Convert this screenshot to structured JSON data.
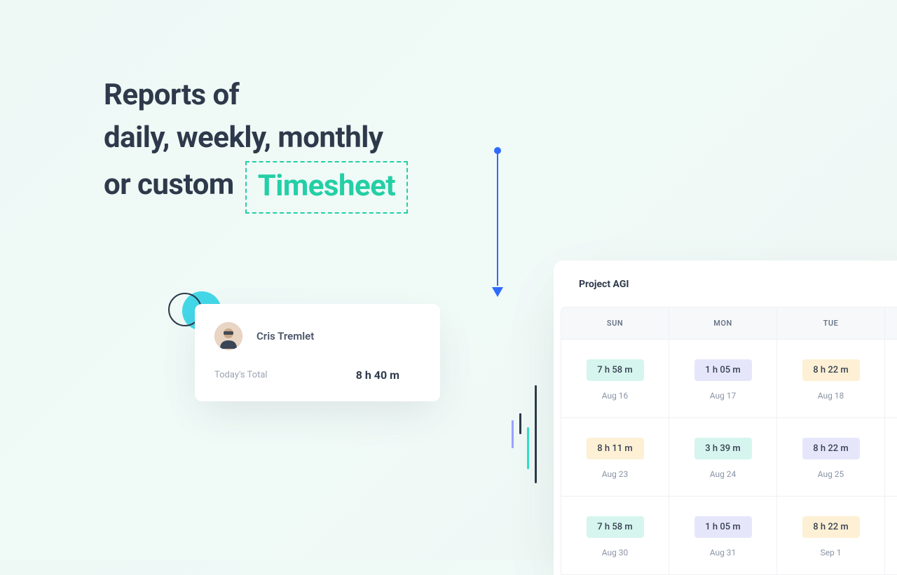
{
  "headline": {
    "line1": "Reports of",
    "line2": "daily, weekly, monthly",
    "line3_prefix": "or custom",
    "highlight": "Timesheet"
  },
  "user_card": {
    "name": "Cris Tremlet",
    "today_label": "Today's Total",
    "today_value": "8 h 40 m"
  },
  "panel": {
    "title": "Project AGI",
    "columns": [
      "SUN",
      "MON",
      "TUE"
    ],
    "rows": [
      [
        {
          "value": "7 h 58 m",
          "date": "Aug 16",
          "tone": "teal"
        },
        {
          "value": "1 h 05 m",
          "date": "Aug 17",
          "tone": "lav"
        },
        {
          "value": "8 h 22 m",
          "date": "Aug 18",
          "tone": "amber"
        }
      ],
      [
        {
          "value": "8 h 11 m",
          "date": "Aug 23",
          "tone": "amber"
        },
        {
          "value": "3 h 39 m",
          "date": "Aug 24",
          "tone": "teal"
        },
        {
          "value": "8 h 22 m",
          "date": "Aug 25",
          "tone": "lav"
        }
      ],
      [
        {
          "value": "7 h 58 m",
          "date": "Aug 30",
          "tone": "teal"
        },
        {
          "value": "1 h 05 m",
          "date": "Aug 31",
          "tone": "lav"
        },
        {
          "value": "8 h 22 m",
          "date": "Sep 1",
          "tone": "amber"
        }
      ]
    ]
  }
}
